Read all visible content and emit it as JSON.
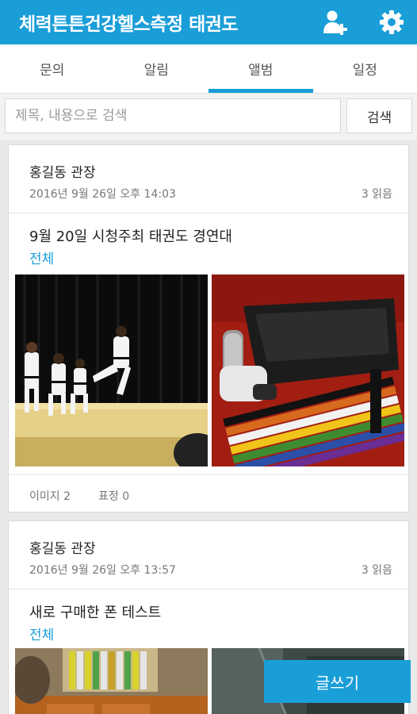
{
  "app": {
    "title": "체력튼튼건강헬스측정 태권도",
    "add_user_icon": "add-user-icon",
    "settings_icon": "gear-icon",
    "accent": "#1a9ed8"
  },
  "tabs": [
    {
      "label": "문의",
      "active": false
    },
    {
      "label": "알림",
      "active": false
    },
    {
      "label": "앨범",
      "active": true
    },
    {
      "label": "일정",
      "active": false
    }
  ],
  "search": {
    "placeholder": "제목, 내용으로 검색",
    "value": "",
    "button_label": "검색"
  },
  "posts": [
    {
      "author": "홍길동 관장",
      "date": "2016년 9월 26일 오후 14:03",
      "reads": "3 읽음",
      "title": "9월 20일 시청주최 태권도 경연대",
      "scope": "전체",
      "images_stat": "이미지 2",
      "emotes_stat": "표정 0"
    },
    {
      "author": "홍길동 관장",
      "date": "2016년 9월 26일 오후 13:57",
      "reads": "3 읽음",
      "title": "새로 구매한 폰 테스트",
      "scope": "전체"
    }
  ],
  "fab": {
    "label": "글쓰기"
  }
}
